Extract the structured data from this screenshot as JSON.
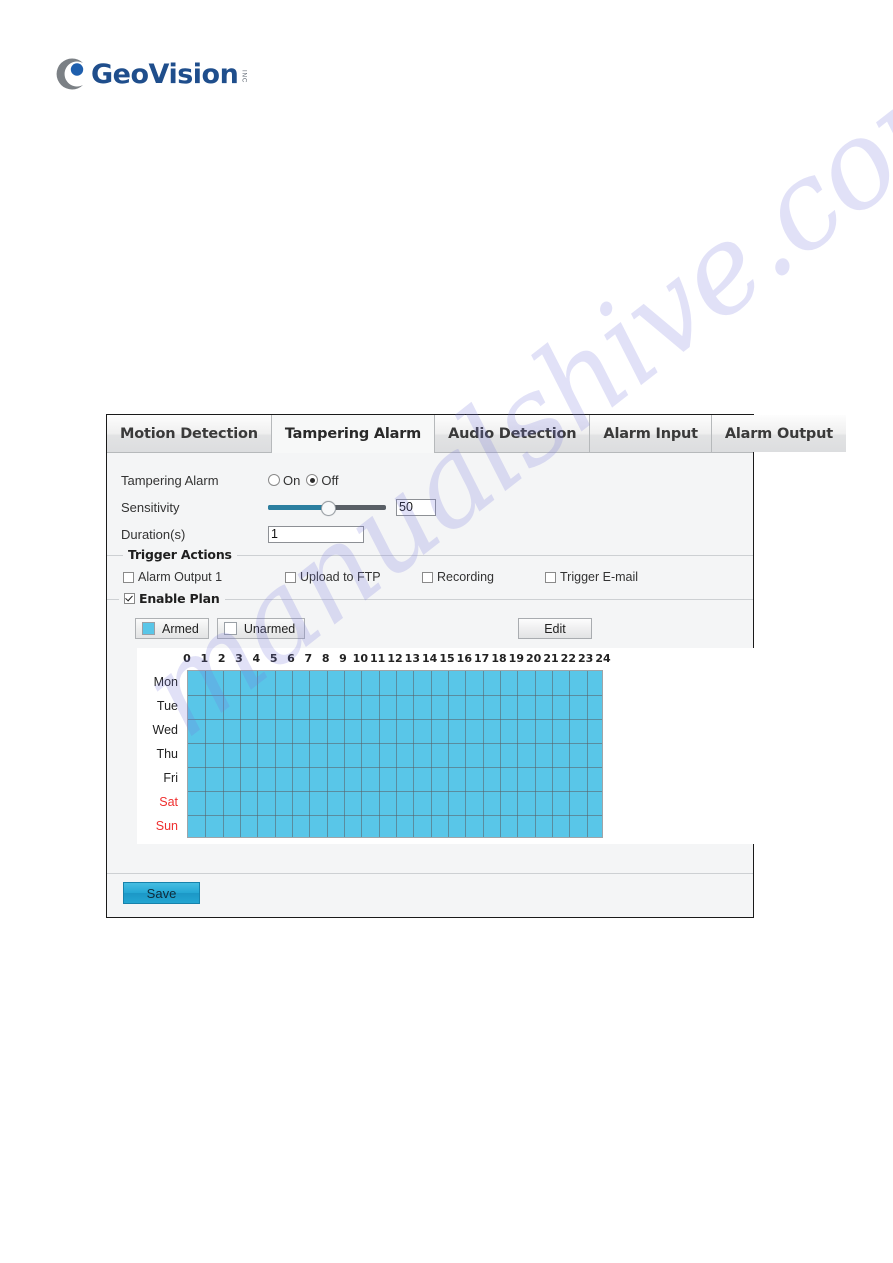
{
  "brand": {
    "name": "GeoVision",
    "suffix": "INC",
    "logo_icon": "geovision-c-logo",
    "text_color": "#1F4E8C"
  },
  "watermark": {
    "text": "manualshive.com",
    "color": "#7678dc"
  },
  "tabs": [
    {
      "label": "Motion Detection",
      "active": false
    },
    {
      "label": "Tampering Alarm",
      "active": true
    },
    {
      "label": "Audio Detection",
      "active": false
    },
    {
      "label": "Alarm Input",
      "active": false
    },
    {
      "label": "Alarm Output",
      "active": false
    }
  ],
  "settings": {
    "tampering_alarm": {
      "label": "Tampering Alarm",
      "options": [
        {
          "label": "On",
          "selected": false
        },
        {
          "label": "Off",
          "selected": true
        }
      ]
    },
    "sensitivity": {
      "label": "Sensitivity",
      "value": "50",
      "percent": 50,
      "fill_color": "#2b7fa0",
      "track_color": "#595f66"
    },
    "duration": {
      "label": "Duration(s)",
      "value": "1"
    }
  },
  "trigger_actions": {
    "title": "Trigger Actions",
    "items": [
      {
        "label": "Alarm Output 1",
        "checked": false
      },
      {
        "label": "Upload to FTP",
        "checked": false
      },
      {
        "label": "Recording",
        "checked": false
      },
      {
        "label": "Trigger E-mail",
        "checked": false
      }
    ]
  },
  "plan": {
    "title": "Enable Plan",
    "enabled": true,
    "legend": [
      {
        "label": "Armed",
        "color": "#59c6e8"
      },
      {
        "label": "Unarmed",
        "color": "#ffffff"
      }
    ],
    "edit_label": "Edit",
    "schedule": {
      "hours": [
        "0",
        "1",
        "2",
        "3",
        "4",
        "5",
        "6",
        "7",
        "8",
        "9",
        "10",
        "11",
        "12",
        "13",
        "14",
        "15",
        "16",
        "17",
        "18",
        "19",
        "20",
        "21",
        "22",
        "23",
        "24"
      ],
      "days": [
        {
          "label": "Mon",
          "weekend": false,
          "armed_hours": [
            0,
            24
          ]
        },
        {
          "label": "Tue",
          "weekend": false,
          "armed_hours": [
            0,
            24
          ]
        },
        {
          "label": "Wed",
          "weekend": false,
          "armed_hours": [
            0,
            24
          ]
        },
        {
          "label": "Thu",
          "weekend": false,
          "armed_hours": [
            0,
            24
          ]
        },
        {
          "label": "Fri",
          "weekend": false,
          "armed_hours": [
            0,
            24
          ]
        },
        {
          "label": "Sat",
          "weekend": true,
          "armed_hours": [
            0,
            24
          ]
        },
        {
          "label": "Sun",
          "weekend": true,
          "armed_hours": [
            0,
            24
          ]
        }
      ],
      "armed_color": "#59c6e8",
      "grid_line_color": "#5a5f64"
    }
  },
  "footer": {
    "save_label": "Save"
  }
}
